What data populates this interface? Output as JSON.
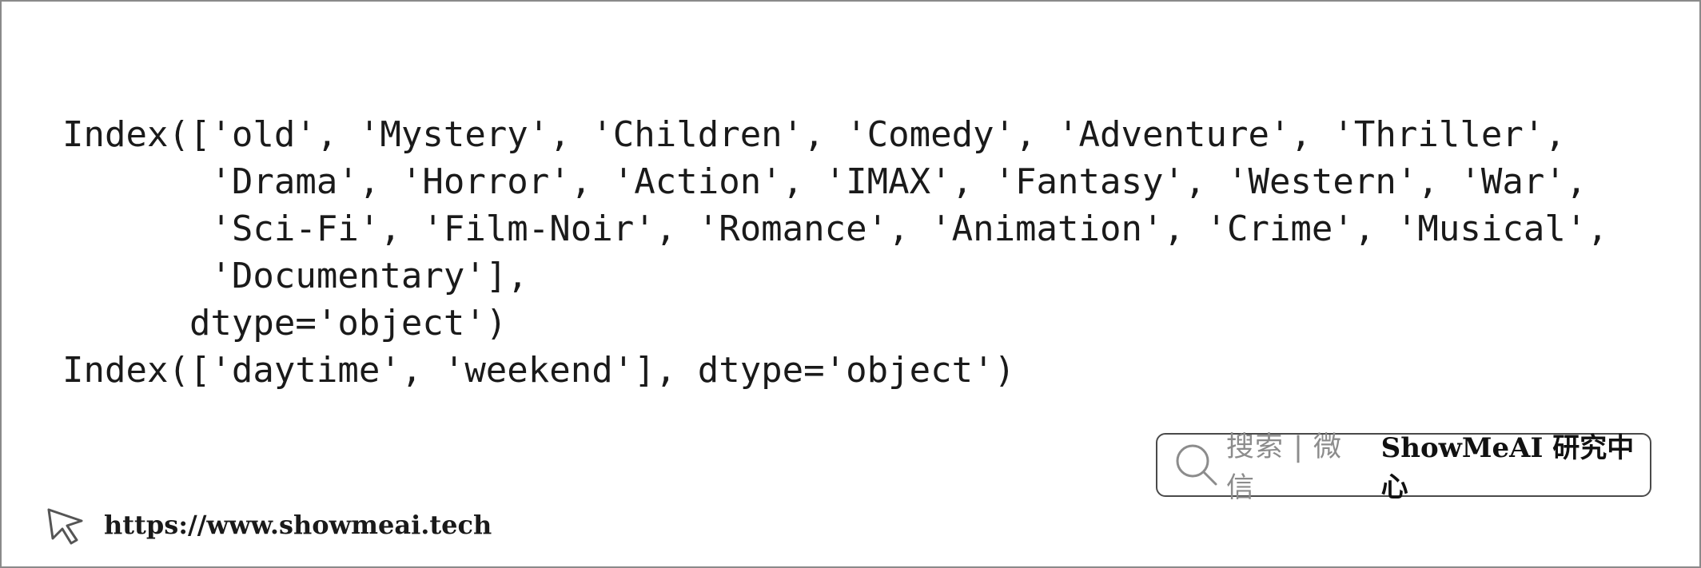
{
  "code": {
    "lines": [
      "Index(['old', 'Mystery', 'Children', 'Comedy', 'Adventure', 'Thriller',",
      "       'Drama', 'Horror', 'Action', 'IMAX', 'Fantasy', 'Western', 'War',",
      "       'Sci-Fi', 'Film-Noir', 'Romance', 'Animation', 'Crime', 'Musical',",
      "       'Documentary'],",
      "      dtype='object')",
      "Index(['daytime', 'weekend'], dtype='object')"
    ]
  },
  "search_box": {
    "hint": "搜索 | 微信",
    "brand": "ShowMeAI 研究中心",
    "icon": "search-icon"
  },
  "footer": {
    "url": "https://www.showmeai.tech",
    "icon": "cursor-pointer-icon"
  },
  "colors": {
    "border": "#8a8a8a",
    "text": "#1a1a1a",
    "hint": "#8c8c8c"
  }
}
